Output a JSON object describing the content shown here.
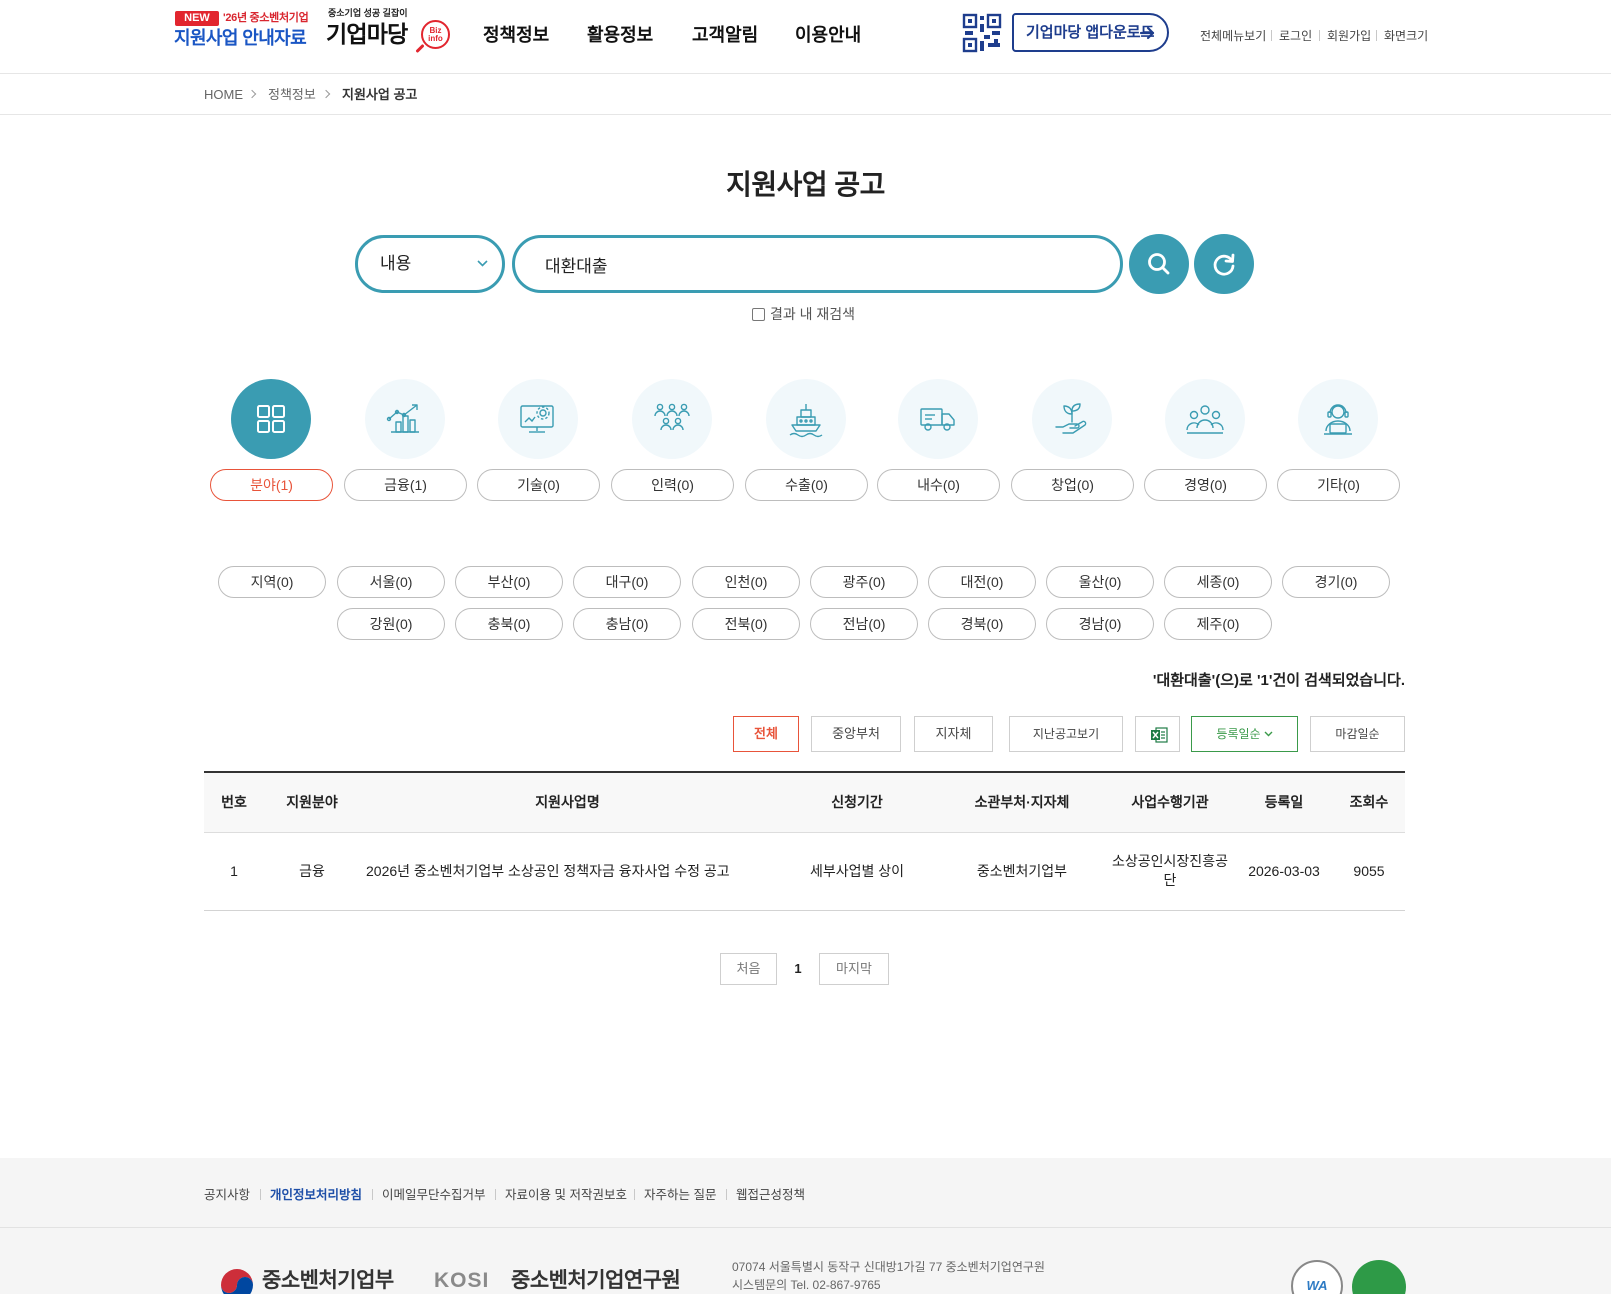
{
  "header": {
    "logo": {
      "badge": "NEW",
      "year_text": "'26년 중소벤처기업",
      "guide_text": "지원사업 안내자료",
      "tagline": "중소기업 성공 길잡이",
      "brand": "기업마당",
      "biz_line1": "Biz",
      "biz_line2": "info"
    },
    "nav": [
      {
        "label": "정책정보"
      },
      {
        "label": "활용정보"
      },
      {
        "label": "고객알림"
      },
      {
        "label": "이용안내"
      }
    ],
    "app_download": {
      "label": "기업마당 앱다운로드",
      "icon": "qr-code-icon"
    },
    "util": [
      {
        "label": "전체메뉴보기"
      },
      {
        "label": "로그인"
      },
      {
        "label": "회원가입"
      },
      {
        "label": "화면크기"
      }
    ]
  },
  "breadcrumb": [
    {
      "label": "HOME"
    },
    {
      "label": "정책정보"
    },
    {
      "label": "지원사업 공고"
    }
  ],
  "page_title": "지원사업 공고",
  "search": {
    "select_value": "내용",
    "query": "대환대출",
    "research_label": "결과 내 재검색",
    "research_checked": false
  },
  "categories": [
    {
      "label": "분야(1)",
      "icon": "grid-icon",
      "active": true
    },
    {
      "label": "금융(1)",
      "icon": "growth-chart-icon",
      "active": false
    },
    {
      "label": "기술(0)",
      "icon": "monitor-gear-icon",
      "active": false
    },
    {
      "label": "인력(0)",
      "icon": "people-group-icon",
      "active": false
    },
    {
      "label": "수출(0)",
      "icon": "ship-icon",
      "active": false
    },
    {
      "label": "내수(0)",
      "icon": "truck-icon",
      "active": false
    },
    {
      "label": "창업(0)",
      "icon": "sprout-hand-icon",
      "active": false
    },
    {
      "label": "경영(0)",
      "icon": "management-team-icon",
      "active": false
    },
    {
      "label": "기타(0)",
      "icon": "support-agent-icon",
      "active": false
    }
  ],
  "regions": [
    {
      "label": "지역(0)"
    },
    {
      "label": "서울(0)"
    },
    {
      "label": "부산(0)"
    },
    {
      "label": "대구(0)"
    },
    {
      "label": "인천(0)"
    },
    {
      "label": "광주(0)"
    },
    {
      "label": "대전(0)"
    },
    {
      "label": "울산(0)"
    },
    {
      "label": "세종(0)"
    },
    {
      "label": "경기(0)"
    },
    {
      "label": "강원(0)"
    },
    {
      "label": "충북(0)"
    },
    {
      "label": "충남(0)"
    },
    {
      "label": "전북(0)"
    },
    {
      "label": "전남(0)"
    },
    {
      "label": "경북(0)"
    },
    {
      "label": "경남(0)"
    },
    {
      "label": "제주(0)"
    }
  ],
  "result_message": "'대환대출'(으)로 '1'건이 검색되었습니다.",
  "filters": {
    "all": "전체",
    "central": "중앙부처",
    "local": "지자체",
    "past": "지난공고보기",
    "excel_icon": "excel-download-icon",
    "sort_reg": "등록일순",
    "sort_deadline": "마감일순"
  },
  "table": {
    "headers": [
      "번호",
      "지원분야",
      "지원사업명",
      "신청기간",
      "소관부처·지자체",
      "사업수행기관",
      "등록일",
      "조회수"
    ],
    "rows": [
      {
        "no": "1",
        "field": "금융",
        "title": "2026년 중소벤처기업부 소상공인 정책자금 융자사업 수정 공고",
        "period": "세부사업별 상이",
        "ministry": "중소벤처기업부",
        "agency": "소상공인시장진흥공단",
        "reg_date": "2026-03-03",
        "views": "9055"
      }
    ]
  },
  "pagination": {
    "first": "처음",
    "current": "1",
    "last": "마지막"
  },
  "footer": {
    "links": [
      {
        "label": "공지사항"
      },
      {
        "label": "개인정보처리방침"
      },
      {
        "label": "이메일무단수집거부"
      },
      {
        "label": "자료이용 및 저작권보호"
      },
      {
        "label": "자주하는 질문"
      },
      {
        "label": "웹접근성정책"
      }
    ],
    "logos": {
      "mss": "중소벤처기업부",
      "kosi_mark": "KOSI",
      "kosi_name": "중소벤처기업연구원"
    },
    "address": "07074 서울특별시 동작구 신대방1가길 77 중소벤처기업연구원",
    "contact": "시스템문의 Tel. 02-867-9765",
    "badge": "WA"
  },
  "colors": {
    "accent": "#3a9cb2",
    "active": "#e8543a",
    "brand_blue": "#1e3d8d",
    "sort_green": "#3a9a4a"
  }
}
